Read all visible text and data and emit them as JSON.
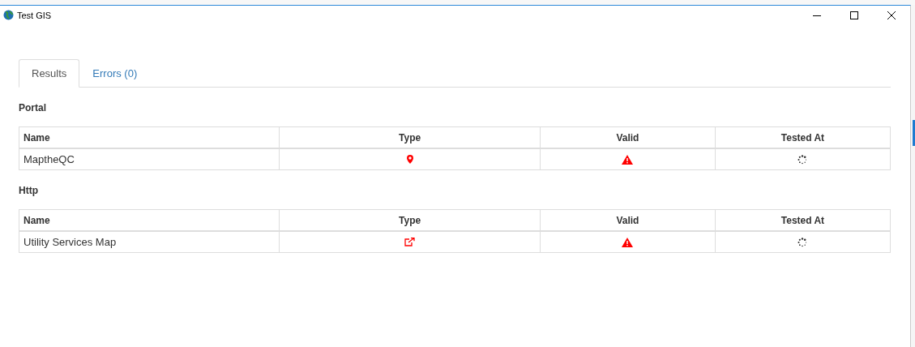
{
  "window": {
    "title": "Test GIS"
  },
  "tabs": [
    {
      "label": "Results",
      "selected": true
    },
    {
      "label": "Errors (0)",
      "selected": false
    }
  ],
  "sections": [
    {
      "title": "Portal",
      "columns": [
        "Name",
        "Type",
        "Valid",
        "Tested At"
      ],
      "rows": [
        {
          "name": "MaptheQC",
          "type": {
            "kind": "marker"
          },
          "valid": {
            "kind": "warning"
          },
          "tested_at": {
            "kind": "spinner"
          }
        }
      ]
    },
    {
      "title": "Http",
      "columns": [
        "Name",
        "Type",
        "Valid",
        "Tested At"
      ],
      "rows": [
        {
          "name": "Utility Services Map",
          "type": {
            "kind": "external-link"
          },
          "valid": {
            "kind": "warning"
          },
          "tested_at": {
            "kind": "spinner"
          }
        }
      ]
    }
  ]
}
